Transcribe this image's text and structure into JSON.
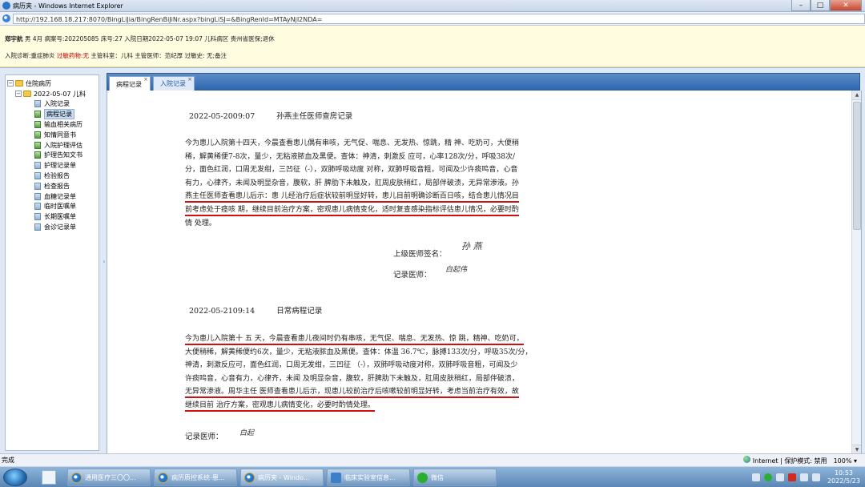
{
  "window": {
    "title": "病历夹 - Windows Internet Explorer",
    "url": "http://192.168.18.217:8070/BingLiJia/BingRenBiJiNr.aspx?bingLiSJ=&BingRenId=MTAyNjI2NDA="
  },
  "patient": {
    "line1": {
      "name": "郑宇航",
      "sex_age": "男 4月",
      "case_no": "病案号:202205085",
      "bed": "床号:27",
      "admit": "入院日期2022-05-07 19:07",
      "ward": "儿科病区",
      "insurance": "贵州省医保",
      "exam": ";退休"
    },
    "line2": {
      "diagnosis_label": "入院诊断:重症肺炎",
      "allergy": "过敏药物:无",
      "dept": "主管科室：儿科",
      "doctor": "主管医师：范纪厚",
      "allergy_history": "过敏史: 无;备注"
    }
  },
  "tree": {
    "root": "住院病历",
    "visit": "2022-05-07 儿科",
    "items": [
      {
        "label": "入院记录",
        "icon": "document-icon",
        "selected": false
      },
      {
        "label": "病程记录",
        "icon": "document-green-icon",
        "selected": true
      },
      {
        "label": "输血相关病历",
        "icon": "document-green-icon",
        "selected": false
      },
      {
        "label": "知情同意书",
        "icon": "document-green-icon",
        "selected": false
      },
      {
        "label": "入院护理评估",
        "icon": "document-green-icon",
        "selected": false
      },
      {
        "label": "护理告知文书",
        "icon": "document-green-icon",
        "selected": false
      },
      {
        "label": "护理记录单",
        "icon": "document-icon",
        "selected": false
      },
      {
        "label": "检验报告",
        "icon": "document-icon",
        "selected": false
      },
      {
        "label": "检查报告",
        "icon": "document-icon",
        "selected": false
      },
      {
        "label": "血糖记录单",
        "icon": "document-icon",
        "selected": false
      },
      {
        "label": "临时医嘱单",
        "icon": "document-icon",
        "selected": false
      },
      {
        "label": "长期医嘱单",
        "icon": "document-icon",
        "selected": false
      },
      {
        "label": "会诊记录单",
        "icon": "document-icon",
        "selected": false
      }
    ]
  },
  "tabs": [
    {
      "label": "病程记录",
      "close": "×"
    },
    {
      "label": "入院记录",
      "close": "×"
    }
  ],
  "records": [
    {
      "datetime": "2022-05-2009:07",
      "title": "孙燕主任医师查房记录",
      "lines": [
        "今为患儿入院第十四天，今晨查看患儿偶有串咳，无气促、喘息、无发热、惊跳，精 神、吃奶可，大便稍",
        "稀，解黄稀便7-8次，量少，无粘液脓血及黑便。查体：神清，刺激反 应可，心率128次/分，呼吸38次/",
        "分，面色红润，口周无发绀，三凹征（-），双肺呼吸动度 对称，双肺呼吸音粗，可闻及少许痰鸣音，心音",
        "有力，心律齐，未闻及明显杂音，腹软，肝 脾肋下未触及，肛周皮肤稍红，局部伴破溃，无异常渗液。孙",
        "燕主任医师查看患儿后示：患 儿经治疗后症状较前明显好转，患儿目前明确诊断百日咳，结合患儿情况目",
        "前考虑处于痉咳 期，继续目前治疗方案，密观患儿病情变化，适时复查感染指标评估患儿情况，必要时酌",
        "情 处理。"
      ],
      "superior_sign_label": "上级医师签名：",
      "superior_signature": "孙 燕",
      "recorder_label": "记录医师：",
      "recorder_signature": "白起伟"
    },
    {
      "datetime": "2022-05-2109:14",
      "title": "日常病程记录",
      "lines": [
        "今为患儿入院第十 五 天，今晨查看患儿夜间时仍有串咳，无气促、喘息、无发热、惊 跳，精神、吃奶可，",
        "大便稍稀，解黄稀便约6次，量少，无粘液脓血及黑便。查体：体温 36.7℃，脉搏133次/分，呼吸35次/分，",
        "神清，刺激反应可，面色红润，口周无发绀，三凹征 （-），双肺呼吸动度对称，双肺呼吸音粗，可闻及少",
        "许痰鸣音，心音有力，心律齐，未闻 及明显杂音，腹软，肝脾肋下未触及，肛周皮肤稍红，局部伴破溃，",
        "无异常渗液。周华主任 医师查看患儿后示，现患儿较前治疗后咳嗽较前明显好转，考虑当前治疗有效，故",
        "继续目前 治疗方案，密观患儿病情变化，必要时酌情处理。"
      ],
      "recorder_label": "记录医师：",
      "recorder_signature": "白起"
    }
  ],
  "status": {
    "left": "完成",
    "zone": "Internet | 保护模式: 禁用",
    "zoom": "100%"
  },
  "taskbar": {
    "tasks": [
      {
        "label": "通用医疗三〇〇...",
        "icon": "ie-icon"
      },
      {
        "label": "病历质控系统-患...",
        "icon": "ie-icon"
      },
      {
        "label": "病历夹 - Windo...",
        "icon": "ie-icon"
      },
      {
        "label": "临床实验室信息...",
        "icon": "app-icon"
      },
      {
        "label": "微信",
        "icon": "wechat-icon"
      }
    ],
    "time": "10:53",
    "date": "2022/5/23"
  }
}
